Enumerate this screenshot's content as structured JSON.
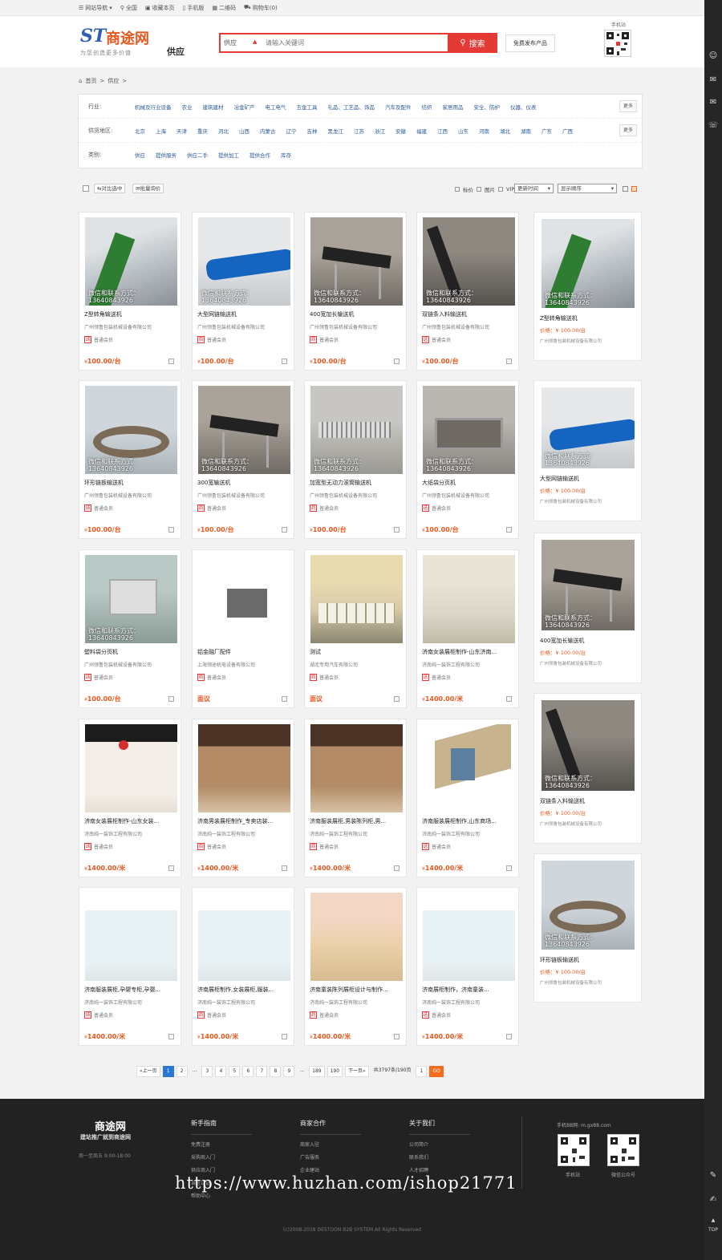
{
  "topbar": {
    "nav": "网站导航",
    "city": "全国",
    "fav": "收藏本页",
    "mobile": "手机版",
    "qrcode": "二维码",
    "cart": "购物车(0)"
  },
  "header": {
    "logo_st": "ST",
    "logo_name": "商途网",
    "slogan": "为您创造更多价值",
    "section": "供应",
    "search_cat": "供应",
    "search_placeholder": "请输入关键词",
    "search_btn": "搜索",
    "free_publish": "免费发布产品",
    "mobile_label": "手机站"
  },
  "breadcrumb": {
    "home": "首页",
    "sep1": ">",
    "cur": "供应",
    "sep2": ">"
  },
  "filters": [
    {
      "label": "行业:",
      "options": [
        "机械及行业设备",
        "农业",
        "建筑建材",
        "冶金矿产",
        "电工电气",
        "五金工具",
        "礼品、工艺品、饰品",
        "汽车及配件",
        "纺织",
        "家居用品",
        "安全、防护",
        "仪器、仪表"
      ],
      "more": "更多"
    },
    {
      "label": "供货地区:",
      "options": [
        "北京",
        "上海",
        "天津",
        "重庆",
        "河北",
        "山西",
        "内蒙古",
        "辽宁",
        "吉林",
        "黑龙江",
        "江苏",
        "浙江",
        "安徽",
        "福建",
        "江西",
        "山东",
        "河南",
        "湖北",
        "湖南",
        "广东",
        "广西"
      ],
      "more": "更多"
    },
    {
      "label": "类别:",
      "options": [
        "供应",
        "提供服务",
        "供应二手",
        "提供加工",
        "提供合作",
        "库存"
      ]
    }
  ],
  "toolbar": {
    "compare": "对比选中",
    "inquiry": "批量询价",
    "f_price": "标价",
    "f_img": "图片",
    "f_vip": "VIP",
    "sort1": "更新时间",
    "sort2": "显示顺序"
  },
  "products": [
    {
      "title": "Z型转角输送机",
      "company": "广州领鲁包装机械设备有限公司",
      "member": "普通会员",
      "tag": "诚",
      "price": "100.00",
      "unit": "/台",
      "img": "conv-green",
      "wm": true
    },
    {
      "title": "大型网链输送机",
      "company": "广州领鲁包装机械设备有限公司",
      "member": "普通会员",
      "tag": "商",
      "price": "100.00",
      "unit": "/台",
      "img": "conv-blue",
      "wm": true
    },
    {
      "title": "400宽加长输送机",
      "company": "广州领鲁包装机械设备有限公司",
      "member": "普通会员",
      "tag": "商",
      "price": "100.00",
      "unit": "/台",
      "img": "conv-black",
      "wm": true
    },
    {
      "title": "双链条入料输送机",
      "company": "广州领鲁包装机械设备有限公司",
      "member": "普通会员",
      "tag": "选",
      "price": "100.00",
      "unit": "/台",
      "img": "conv-dark",
      "wm": true
    },
    {
      "title": "环形链板输送机",
      "company": "广州领鲁包装机械设备有限公司",
      "member": "普通会员",
      "tag": "诚",
      "price": "100.00",
      "unit": "/台",
      "img": "conv-ring",
      "wm": true
    },
    {
      "title": "300宽输送机",
      "company": "广州领鲁包装机械设备有限公司",
      "member": "普通会员",
      "tag": "商",
      "price": "100.00",
      "unit": "/台",
      "img": "conv-black",
      "wm": true
    },
    {
      "title": "加宽型无动力滚筒输送机",
      "company": "广州领鲁包装机械设备有限公司",
      "member": "普通会员",
      "tag": "商",
      "price": "100.00",
      "unit": "/台",
      "img": "conv-roller",
      "wm": true
    },
    {
      "title": "大纸袋分页机",
      "company": "广州领鲁包装机械设备有限公司",
      "member": "普通会员",
      "tag": "选",
      "price": "100.00",
      "unit": "/台",
      "img": "conv-steel",
      "wm": true
    },
    {
      "title": "塑料袋分页机",
      "company": "广州领鲁包装机械设备有限公司",
      "member": "普通会员",
      "tag": "诚",
      "price": "100.00",
      "unit": "/台",
      "img": "conv-machine",
      "wm": true
    },
    {
      "title": "铝金融厂配件",
      "company": "上海领途机电设备有限公司",
      "member": "普通会员",
      "tag": "商",
      "price": "面议",
      "unit": "",
      "img": "small-part",
      "wm": false
    },
    {
      "title": "测试",
      "company": "湖北专用汽车有限公司",
      "member": "普通会员",
      "tag": "商",
      "price": "面议",
      "unit": "",
      "img": "bus",
      "wm": false
    },
    {
      "title": "济南女装展柜制作-山东济南...",
      "company": "济南纯一装饰工程有限公司",
      "member": "普通会员",
      "tag": "选",
      "price": "1400.00",
      "unit": "/米",
      "img": "store-light",
      "wm": false
    },
    {
      "title": "济南女装展柜制作-山东女装...",
      "company": "济南纯一装饰工程有限公司",
      "member": "普通会员",
      "tag": "诚",
      "price": "1400.00",
      "unit": "/米",
      "img": "store-red",
      "wm": false
    },
    {
      "title": "济南男装展柜制作_专卖店装...",
      "company": "济南纯一装饰工程有限公司",
      "member": "普通会员",
      "tag": "商",
      "price": "1400.00",
      "unit": "/米",
      "img": "store-wood",
      "wm": false
    },
    {
      "title": "济南服装展柜,男装陈列柜,男...",
      "company": "济南纯一装饰工程有限公司",
      "member": "普通会员",
      "tag": "商",
      "price": "1400.00",
      "unit": "/米",
      "img": "store-wood",
      "wm": false
    },
    {
      "title": "济南服装展柜制作,山东商场...",
      "company": "济南纯一装饰工程有限公司",
      "member": "普通会员",
      "tag": "选",
      "price": "1400.00",
      "unit": "/米",
      "img": "store-3d",
      "wm": false
    },
    {
      "title": "济南服装展柜,孕婴专柜,孕婴...",
      "company": "济南纯一装饰工程有限公司",
      "member": "普通会员",
      "tag": "诚",
      "price": "1400.00",
      "unit": "/米",
      "img": "store-white",
      "wm": false
    },
    {
      "title": "济南展柜制作,女装展柜,服装...",
      "company": "济南纯一装饰工程有限公司",
      "member": "普通会员",
      "tag": "商",
      "price": "1400.00",
      "unit": "/米",
      "img": "store-white",
      "wm": false
    },
    {
      "title": "济南童装陈列展柜设计与制作...",
      "company": "济南纯一装饰工程有限公司",
      "member": "普通会员",
      "tag": "商",
      "price": "1400.00",
      "unit": "/米",
      "img": "store-kids",
      "wm": false
    },
    {
      "title": "济南展柜制作，济南童装...",
      "company": "济南纯一装饰工程有限公司",
      "member": "普通会员",
      "tag": "选",
      "price": "1400.00",
      "unit": "/米",
      "img": "store-white",
      "wm": false
    }
  ],
  "watermark": {
    "line1": "微信和联系方式：",
    "line2": "13640843926"
  },
  "currency": "¥",
  "sidebar": [
    {
      "title": "Z型转角输送机",
      "price_label": "价格：",
      "price": "¥ 100.00/台",
      "company": "广州领鲁包装机械设备有限公司",
      "img": "conv-green"
    },
    {
      "title": "大型网链输送机",
      "price_label": "价格：",
      "price": "¥ 100.00/台",
      "company": "广州领鲁包装机械设备有限公司",
      "img": "conv-blue"
    },
    {
      "title": "400宽加长输送机",
      "price_label": "价格：",
      "price": "¥ 100.00/台",
      "company": "广州领鲁包装机械设备有限公司",
      "img": "conv-black"
    },
    {
      "title": "双链条入料输送机",
      "price_label": "价格：",
      "price": "¥ 100.00/台",
      "company": "广州领鲁包装机械设备有限公司",
      "img": "conv-dark"
    },
    {
      "title": "环形链板输送机",
      "price_label": "价格：",
      "price": "¥ 100.00/台",
      "company": "广州领鲁包装机械设备有限公司",
      "img": "conv-ring"
    }
  ],
  "pager": {
    "prev": "«上一页",
    "pages": [
      "1",
      "2",
      "...",
      "3",
      "4",
      "5",
      "6",
      "7",
      "8",
      "9",
      "...",
      "189",
      "190"
    ],
    "next": "下一页»",
    "total": "共3797条/190页",
    "input": "1",
    "go": "GO"
  },
  "footer": {
    "logo": "商途网",
    "slogan": "建站推广就到商途网",
    "hours": "周一至周五 9:00-18:00",
    "cols": [
      {
        "title": "新手指南",
        "links": [
          "免费注册",
          "采购商入门",
          "供应商入门",
          "诚信认证",
          "帮助中心"
        ]
      },
      {
        "title": "商家合作",
        "links": [
          "商家入驻",
          "广告服务",
          "企业建站"
        ]
      },
      {
        "title": "关于我们",
        "links": [
          "公司简介",
          "联系我们",
          "人才招聘"
        ]
      }
    ],
    "mobile": "手机BB网: m.gx88.com",
    "qr1": "手机站",
    "qr2": "微信公众号",
    "copyright": "(c)2008-2018 DESTOON B2B SYSTEM All Rights Reserved"
  },
  "url_watermark": "https://www.huzhan.com/ishop21771",
  "rightbar_icons": [
    "user-icon",
    "message-icon",
    "mail-icon",
    "chat-icon",
    "notes-icon",
    "edit-icon",
    "top-icon"
  ],
  "rightbar_top": "TOP",
  "colors": {
    "accent": "#e53935",
    "price": "#e8571e",
    "link": "#2b5aa0",
    "footer": "#222222"
  }
}
